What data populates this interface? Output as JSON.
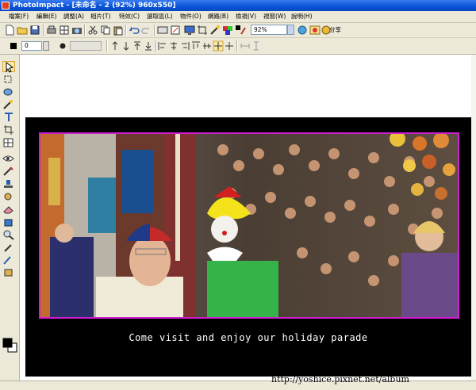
{
  "window": {
    "title": "PhotoImpact - [未命名 - 2 (92%) 960x550]"
  },
  "menu": {
    "items": [
      {
        "label": "檔案(F)"
      },
      {
        "label": "編輯(E)"
      },
      {
        "label": "調整(A)"
      },
      {
        "label": "相片(T)"
      },
      {
        "label": "特效(C)"
      },
      {
        "label": "選取區(L)"
      },
      {
        "label": "物件(O)"
      },
      {
        "label": "網路(B)"
      },
      {
        "label": "檢視(V)"
      },
      {
        "label": "視窗(W)"
      },
      {
        "label": "說明(H)"
      }
    ]
  },
  "toolbar": {
    "zoom_value": "92%",
    "share_label": "分享"
  },
  "attribute_bar": {
    "number_value": "0"
  },
  "image": {
    "caption": "Come visit and enjoy our holiday parade"
  },
  "watermark": "http://yoshice.pixnet.net/album",
  "colors": {
    "title_blue": "#0a55d8",
    "frame_magenta": "#d21ed2",
    "canvas_black": "#000000"
  }
}
